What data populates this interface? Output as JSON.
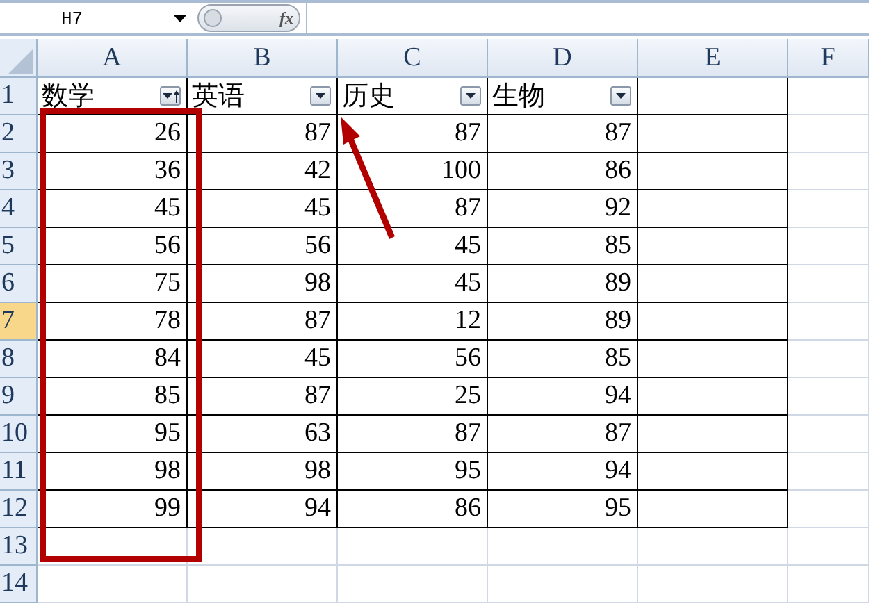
{
  "name_box": {
    "value": "H7"
  },
  "formula_bar": {
    "function_button": "fx"
  },
  "columns": [
    {
      "label": "A"
    },
    {
      "label": "B"
    },
    {
      "label": "C"
    },
    {
      "label": "D"
    },
    {
      "label": "E"
    },
    {
      "label": "F"
    }
  ],
  "rows": [
    {
      "number": "1",
      "selected": false,
      "cells": [
        {
          "kind": "header",
          "text": "数学",
          "sorted": true
        },
        {
          "kind": "header",
          "text": "英语",
          "sorted": false
        },
        {
          "kind": "header",
          "text": "历史",
          "sorted": false
        },
        {
          "kind": "header",
          "text": "生物",
          "sorted": false
        }
      ]
    },
    {
      "number": "2",
      "selected": false,
      "cells": [
        {
          "kind": "number",
          "text": "26"
        },
        {
          "kind": "number",
          "text": "87"
        },
        {
          "kind": "number",
          "text": "87"
        },
        {
          "kind": "number",
          "text": "87"
        }
      ]
    },
    {
      "number": "3",
      "selected": false,
      "cells": [
        {
          "kind": "number",
          "text": "36"
        },
        {
          "kind": "number",
          "text": "42"
        },
        {
          "kind": "number",
          "text": "100"
        },
        {
          "kind": "number",
          "text": "86"
        }
      ]
    },
    {
      "number": "4",
      "selected": false,
      "cells": [
        {
          "kind": "number",
          "text": "45"
        },
        {
          "kind": "number",
          "text": "45"
        },
        {
          "kind": "number",
          "text": "87"
        },
        {
          "kind": "number",
          "text": "92"
        }
      ]
    },
    {
      "number": "5",
      "selected": false,
      "cells": [
        {
          "kind": "number",
          "text": "56"
        },
        {
          "kind": "number",
          "text": "56"
        },
        {
          "kind": "number",
          "text": "45"
        },
        {
          "kind": "number",
          "text": "85"
        }
      ]
    },
    {
      "number": "6",
      "selected": false,
      "cells": [
        {
          "kind": "number",
          "text": "75"
        },
        {
          "kind": "number",
          "text": "98"
        },
        {
          "kind": "number",
          "text": "45"
        },
        {
          "kind": "number",
          "text": "89"
        }
      ]
    },
    {
      "number": "7",
      "selected": true,
      "cells": [
        {
          "kind": "number",
          "text": "78"
        },
        {
          "kind": "number",
          "text": "87"
        },
        {
          "kind": "number",
          "text": "12"
        },
        {
          "kind": "number",
          "text": "89"
        }
      ]
    },
    {
      "number": "8",
      "selected": false,
      "cells": [
        {
          "kind": "number",
          "text": "84"
        },
        {
          "kind": "number",
          "text": "45"
        },
        {
          "kind": "number",
          "text": "56"
        },
        {
          "kind": "number",
          "text": "85"
        }
      ]
    },
    {
      "number": "9",
      "selected": false,
      "cells": [
        {
          "kind": "number",
          "text": "85"
        },
        {
          "kind": "number",
          "text": "87"
        },
        {
          "kind": "number",
          "text": "25"
        },
        {
          "kind": "number",
          "text": "94"
        }
      ]
    },
    {
      "number": "10",
      "selected": false,
      "cells": [
        {
          "kind": "number",
          "text": "95"
        },
        {
          "kind": "number",
          "text": "63"
        },
        {
          "kind": "number",
          "text": "87"
        },
        {
          "kind": "number",
          "text": "87"
        }
      ]
    },
    {
      "number": "11",
      "selected": false,
      "cells": [
        {
          "kind": "number",
          "text": "98"
        },
        {
          "kind": "number",
          "text": "98"
        },
        {
          "kind": "number",
          "text": "95"
        },
        {
          "kind": "number",
          "text": "94"
        }
      ]
    },
    {
      "number": "12",
      "selected": false,
      "cells": [
        {
          "kind": "number",
          "text": "99"
        },
        {
          "kind": "number",
          "text": "94"
        },
        {
          "kind": "number",
          "text": "86"
        },
        {
          "kind": "number",
          "text": "95"
        }
      ]
    },
    {
      "number": "13",
      "selected": false,
      "cells": []
    },
    {
      "number": "14",
      "selected": false,
      "cells": []
    }
  ]
}
